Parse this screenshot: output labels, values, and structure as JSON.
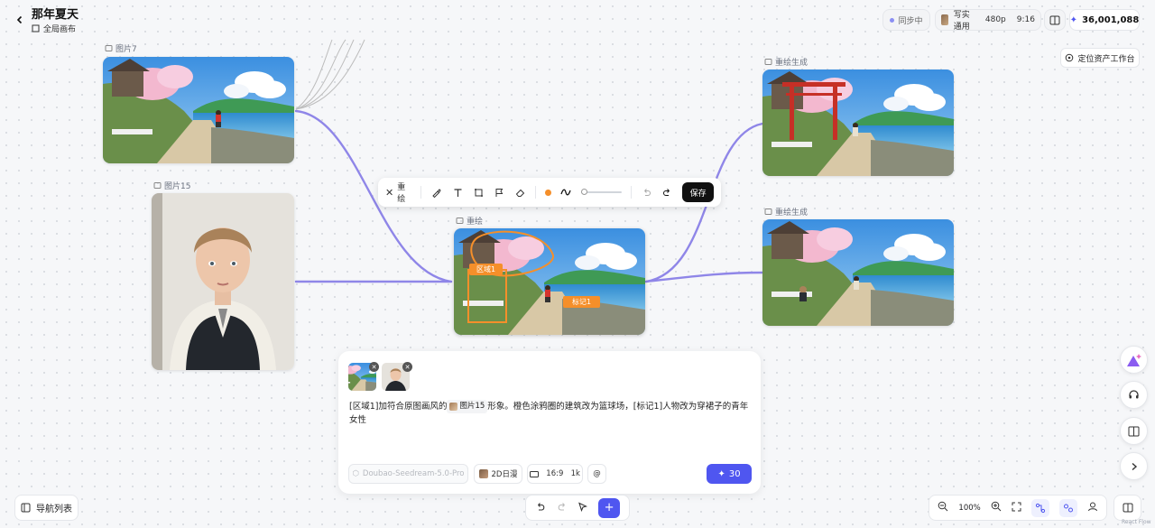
{
  "header": {
    "project_title": "那年夏天",
    "canvas_label": "全局画布",
    "sync_status": "同步中",
    "model_label": "写实通用",
    "resolution": "480p",
    "ratio": "9:16",
    "credits": "36,001,088",
    "locate_label": "定位资产工作台"
  },
  "nodes": {
    "img7_label": "图片7",
    "img15_label": "图片15",
    "redraw_label": "重绘",
    "region_tag": "区域1",
    "marker_tag": "标记1",
    "gen1_label": "重绘生成",
    "gen2_label": "重绘生成"
  },
  "toolbar": {
    "redraw_label": "重绘",
    "save_label": "保存",
    "accent_color": "#f58f2a"
  },
  "prompt": {
    "text_before": "[区域1]加符合原图画风的",
    "chip_label": "图片15",
    "text_after": "形象。橙色涂鸦圈的建筑改为篮球场，[标记1]人物改为穿裙子的青年女性",
    "model": "Doubao-Seedream-5.0-Pro",
    "style": "2D日漫",
    "aspect": "16:9",
    "size": "1k",
    "generate_cost": "30"
  },
  "bottom": {
    "nav_list_label": "导航列表",
    "zoom": "100%",
    "attribution": "React Flow"
  },
  "colors": {
    "accent": "#4f56f0",
    "edge": "#8f86e8"
  }
}
